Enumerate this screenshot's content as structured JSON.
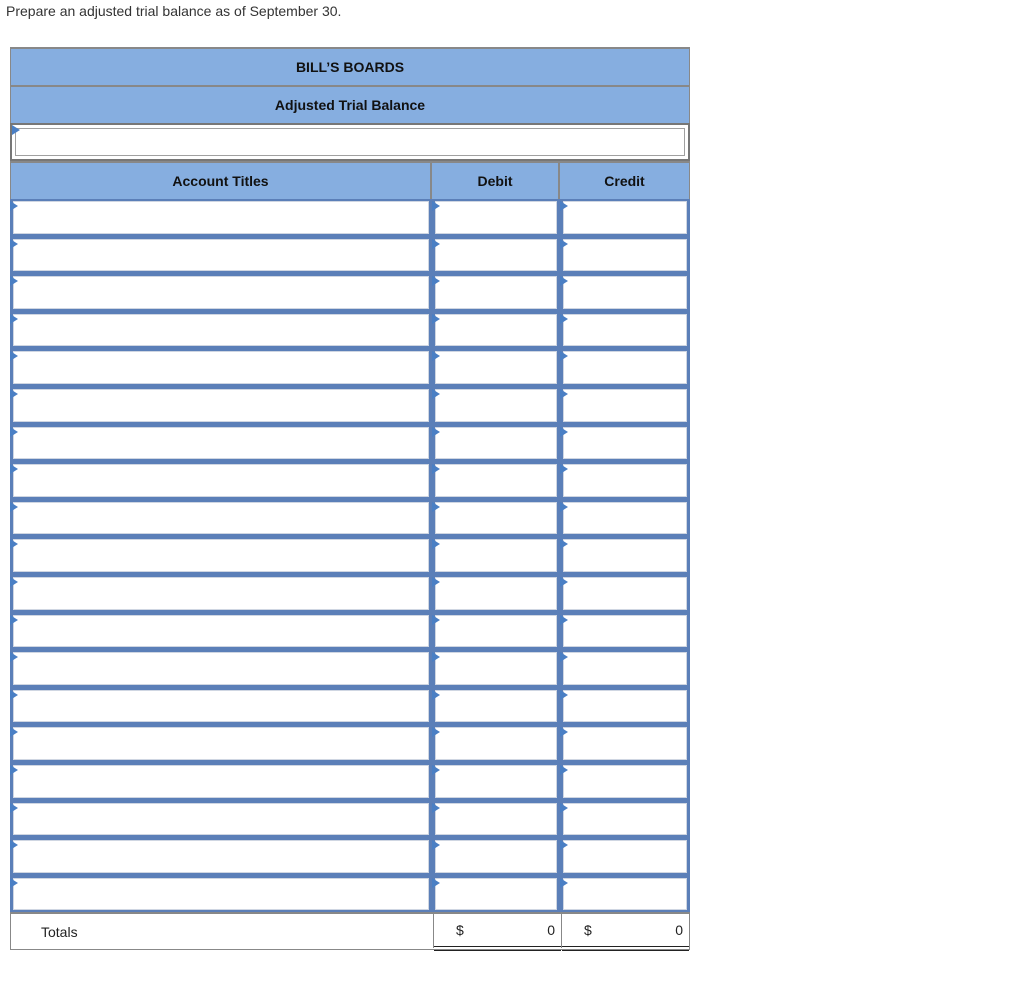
{
  "instruction": "Prepare an adjusted trial balance as of September 30.",
  "worksheet": {
    "company": "BILL’S BOARDS",
    "statement": "Adjusted Trial Balance",
    "date_value": "",
    "columns": {
      "account": "Account Titles",
      "debit": "Debit",
      "credit": "Credit"
    },
    "row_count": 19,
    "totals": {
      "label": "Totals",
      "debit_currency": "$",
      "debit_value": "0",
      "credit_currency": "$",
      "credit_value": "0"
    }
  },
  "colors": {
    "header_blue": "#86aee0",
    "row_border_blue": "#5b7fb8",
    "dropdown_marker": "#4a7fc4"
  }
}
